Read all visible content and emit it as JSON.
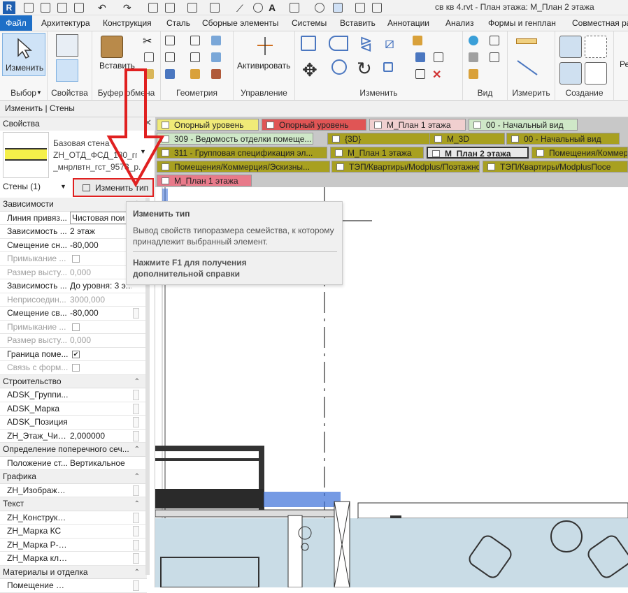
{
  "window": {
    "title": "св кв 4.rvt - План этажа: М_План 2 этажа",
    "logo": "R"
  },
  "menu_tabs": [
    "Файл",
    "Архитектура",
    "Конструкция",
    "Сталь",
    "Сборные элементы",
    "Системы",
    "Вставить",
    "Аннотации",
    "Анализ",
    "Формы и генплан",
    "Совместная ра"
  ],
  "ribbon": {
    "modify_label": "Изменить",
    "paste_label": "Вставить",
    "activate_label": "Активировать",
    "panels": [
      "Выбор",
      "Свойства",
      "Буфер обмена",
      "Геометрия",
      "Управление",
      "Изменить",
      "Вид",
      "Измерить",
      "Создание"
    ],
    "cut_label": "Ре"
  },
  "context_bar": "Изменить | Стены",
  "properties": {
    "title": "Свойства",
    "type_name_1": "Базовая стена",
    "type_name_2": "ZH_ОТД_ФСД_180_гпт",
    "type_name_3": "_мнрлвтн_гст_9573_р...",
    "instance_count": "Стены (1)",
    "edit_type_button": "Изменить тип",
    "rows": [
      {
        "kind": "group",
        "label": "Зависимости"
      },
      {
        "kind": "row",
        "key": "Линия привяз...",
        "value": "Чистовая пои",
        "field": true
      },
      {
        "kind": "row",
        "key": "Зависимость ...",
        "value": "2 этаж"
      },
      {
        "kind": "row",
        "key": "Смещение сн...",
        "value": "-80,000"
      },
      {
        "kind": "row",
        "key": "Примыкание ...",
        "check": false,
        "disabled": true
      },
      {
        "kind": "row",
        "key": "Размер высту...",
        "value": "0,000",
        "disabled": true
      },
      {
        "kind": "row",
        "key": "Зависимость ...",
        "value": "До уровня: 3 э..."
      },
      {
        "kind": "row",
        "key": "Неприсоедин...",
        "value": "3000,000",
        "disabled": true
      },
      {
        "kind": "row",
        "key": "Смещение св...",
        "value": "-80,000",
        "btn": true
      },
      {
        "kind": "row",
        "key": "Примыкание ...",
        "check": false,
        "disabled": true
      },
      {
        "kind": "row",
        "key": "Размер высту...",
        "value": "0,000",
        "disabled": true
      },
      {
        "kind": "row",
        "key": "Граница поме...",
        "check": true
      },
      {
        "kind": "row",
        "key": "Связь с форм...",
        "check": false,
        "disabled": true
      },
      {
        "kind": "group",
        "label": "Строительство"
      },
      {
        "kind": "row",
        "key": "ADSK_Группи...",
        "btn": true
      },
      {
        "kind": "row",
        "key": "ADSK_Марка",
        "btn": true
      },
      {
        "kind": "row",
        "key": "ADSK_Позиция",
        "btn": true
      },
      {
        "kind": "row",
        "key": "ZH_Этаж_Числ...",
        "value": "2,000000",
        "btn": true
      },
      {
        "kind": "group",
        "label": "Определение поперечного сеч..."
      },
      {
        "kind": "row",
        "key": "Положение ст...",
        "value": "Вертикальное"
      },
      {
        "kind": "group",
        "label": "Графика"
      },
      {
        "kind": "row",
        "key": "ZH_Изображе...",
        "btn": true
      },
      {
        "kind": "group",
        "label": "Текст"
      },
      {
        "kind": "row",
        "key": "ZH_Конструкц...",
        "btn": true
      },
      {
        "kind": "row",
        "key": "ZH_Марка КС",
        "btn": true
      },
      {
        "kind": "row",
        "key": "ZH_Марка Р-р...",
        "btn": true
      },
      {
        "kind": "row",
        "key": "ZH_Марка кла...",
        "btn": true
      },
      {
        "kind": "group",
        "label": "Материалы и отделка"
      },
      {
        "kind": "row",
        "key": "Помещение И...",
        "btn": true
      }
    ]
  },
  "view_tabs": [
    {
      "label": "Опорный уровень",
      "color": "#f0ea78"
    },
    {
      "label": "Опорный уровень",
      "color": "#e05555"
    },
    {
      "label": "М_План 1 этажа",
      "color": "#f0cfcf"
    },
    {
      "label": "00 - Начальный вид",
      "color": "#cfe8c8"
    },
    {
      "label": "309 - Ведомость отделки помеще...",
      "color": "#cfe8c8"
    },
    {
      "label": "{3D}",
      "color": "#a8a020"
    },
    {
      "label": "М_3D",
      "color": "#a8a020"
    },
    {
      "label": "00 - Начальный вид",
      "color": "#a8a020"
    },
    {
      "label": "311 - Групповая спецификация эл...",
      "color": "#a8a020"
    },
    {
      "label": "М_План 1 этажа",
      "color": "#a8a020"
    },
    {
      "label": "М_План 2 этажа",
      "color": "#a8a020",
      "active": true
    },
    {
      "label": "Помещения/Коммерц",
      "color": "#a8a020"
    },
    {
      "label": "Помещения/Коммерция/Эскизны...",
      "color": "#a8a020"
    },
    {
      "label": "ТЭП/Квартиры/Modplus/Поэтажно",
      "color": "#a8a020"
    },
    {
      "label": "ТЭП/Квартиры/ModplusПосе",
      "color": "#a8a020"
    },
    {
      "label": "М_План 1 этажа",
      "color": "#e87a8a"
    }
  ],
  "tooltip": {
    "title": "Изменить тип",
    "body": "Вывод свойств типоразмера семейства, к которому принадлежит выбранный элемент.",
    "help": "Нажмите F1 для получения дополнительной справки"
  },
  "colors": {
    "file_tab": "#1e6fc7",
    "highlight": "#e02020",
    "selected": "#3a6fd8"
  }
}
